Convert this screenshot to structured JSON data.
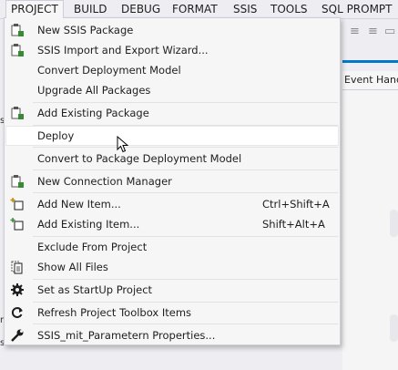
{
  "menubar": {
    "items": [
      "PROJECT",
      "BUILD",
      "DEBUG",
      "FORMAT",
      "SSIS",
      "TOOLS",
      "SQL PROMPT"
    ]
  },
  "document": {
    "tab_label": "Event Handl"
  },
  "menu": {
    "items": [
      {
        "label": "New SSIS Package",
        "icon": "ssis-package-icon",
        "shortcut": ""
      },
      {
        "label": "SSIS Import and Export Wizard...",
        "icon": "ssis-package-icon",
        "shortcut": ""
      },
      {
        "label": "Convert Deployment Model",
        "icon": "",
        "shortcut": ""
      },
      {
        "label": "Upgrade All Packages",
        "icon": "",
        "shortcut": ""
      },
      {
        "label": "Add Existing Package",
        "icon": "ssis-package-icon",
        "shortcut": ""
      },
      {
        "label": "Deploy",
        "icon": "",
        "shortcut": ""
      },
      {
        "label": "Convert to Package Deployment Model",
        "icon": "",
        "shortcut": ""
      },
      {
        "label": "New Connection Manager",
        "icon": "ssis-package-icon",
        "shortcut": ""
      },
      {
        "label": "Add New Item...",
        "icon": "add-new-item-icon",
        "shortcut": "Ctrl+Shift+A"
      },
      {
        "label": "Add Existing Item...",
        "icon": "add-existing-item-icon",
        "shortcut": "Shift+Alt+A"
      },
      {
        "label": "Exclude From Project",
        "icon": "",
        "shortcut": ""
      },
      {
        "label": "Show All Files",
        "icon": "show-all-files-icon",
        "shortcut": ""
      },
      {
        "label": "Set as StartUp Project",
        "icon": "gear-icon",
        "shortcut": ""
      },
      {
        "label": "Refresh Project Toolbox Items",
        "icon": "refresh-icon",
        "shortcut": ""
      },
      {
        "label": "SSIS_mit_Parametern Properties...",
        "icon": "wrench-icon",
        "shortcut": ""
      }
    ],
    "hovered_item": "Deploy"
  },
  "colors": {
    "menu_bg": "#f6f6f6",
    "menu_border": "#cccedb",
    "accent": "#007acc",
    "icon_green": "#388a34"
  }
}
